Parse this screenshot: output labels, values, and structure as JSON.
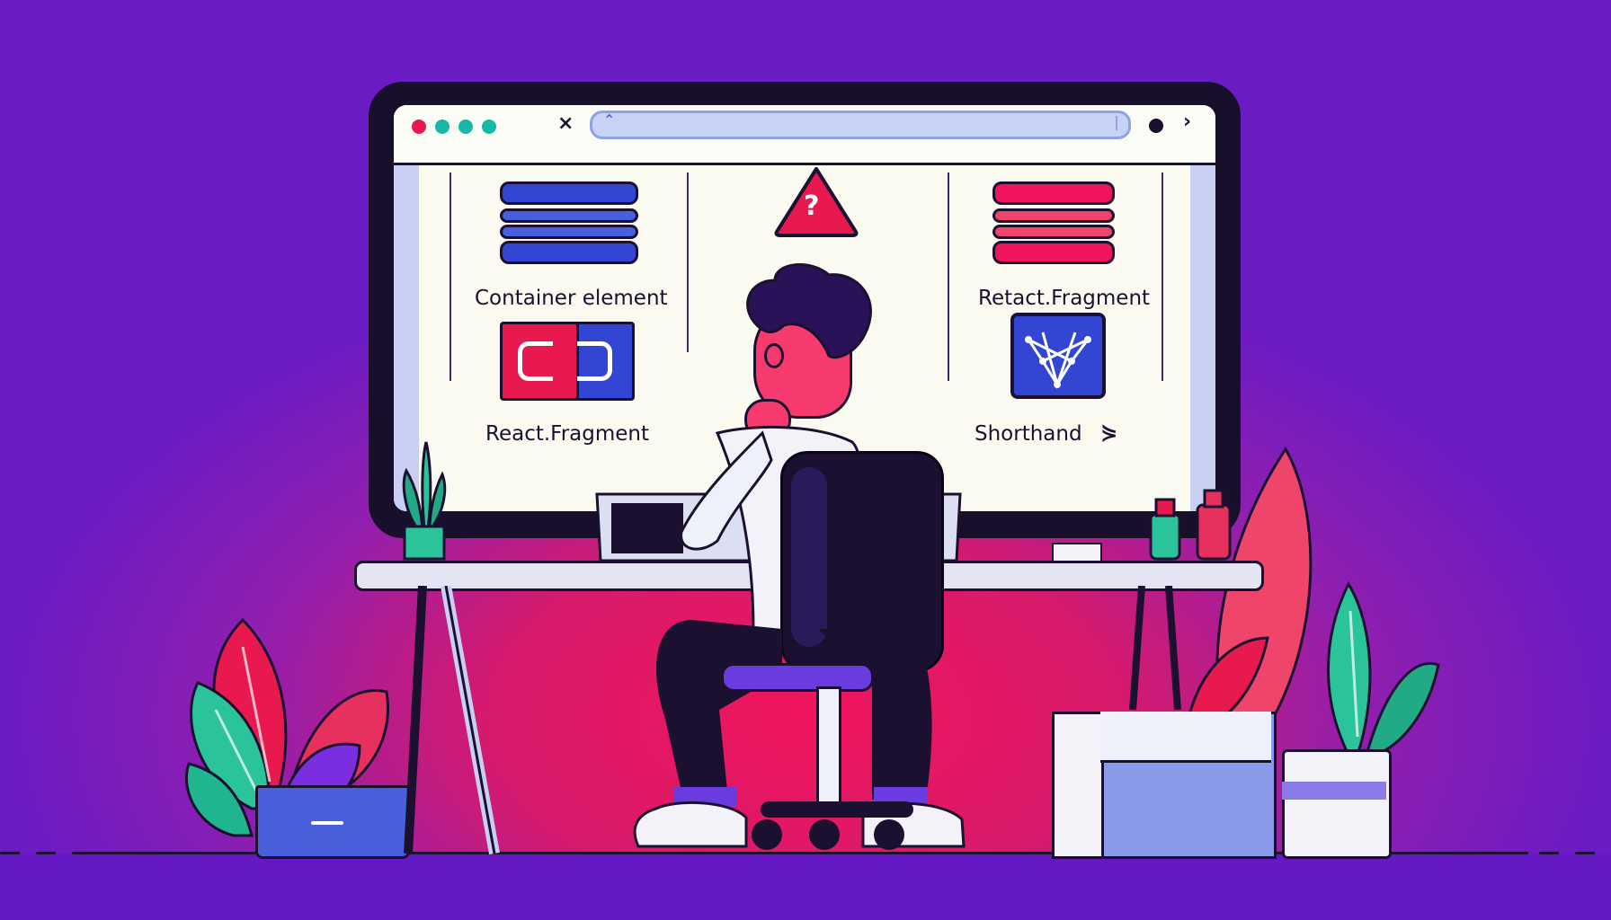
{
  "screen": {
    "left_panel": {
      "top_label": "Container element",
      "bottom_label": "React.Fragment",
      "icon": "c-box-icon"
    },
    "middle_panel": {
      "icon": "question-triangle-icon",
      "icon_text": "?"
    },
    "right_panel": {
      "top_label": "Retact.Fragment",
      "bottom_label": "Shorthand",
      "icon": "fragment-network-icon",
      "trailing_glyph": "⋟"
    },
    "toolbar": {
      "close_glyph": "×",
      "forward_glyph": "›",
      "dot_colors": [
        "#e8194f",
        "#17b8a6",
        "#17b8a6",
        "#17b8a6"
      ]
    }
  },
  "colors": {
    "background": "#6a1bc4",
    "accent_pink": "#f0155d",
    "accent_blue": "#3346d3",
    "ink": "#1c1030"
  }
}
